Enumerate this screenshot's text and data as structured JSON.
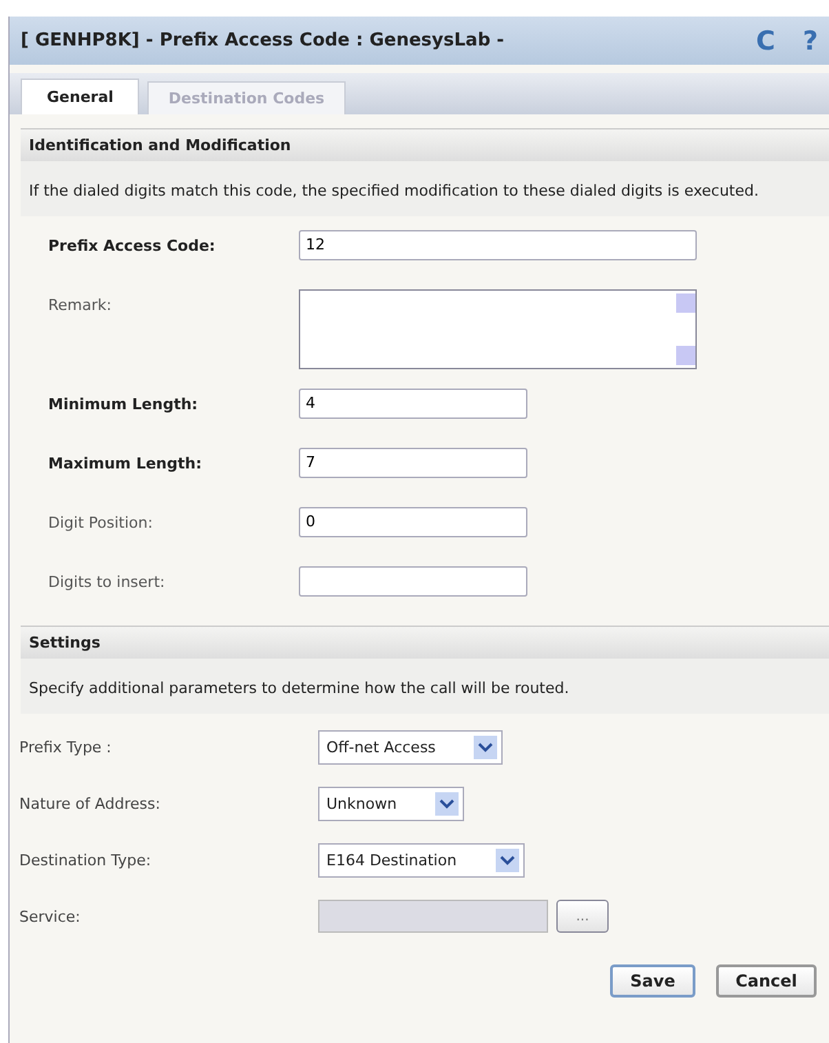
{
  "window": {
    "title": "[ GENHP8K] - Prefix Access Code : GenesysLab -",
    "refresh_icon": "C",
    "help_icon": "?"
  },
  "tabs": [
    {
      "label": "General",
      "selected": true
    },
    {
      "label": "Destination Codes",
      "selected": false
    }
  ],
  "identification": {
    "header": "Identification and Modification",
    "description": "If the dialed digits match this code, the specified modification to these dialed digits is executed.",
    "fields": [
      {
        "kind": "text",
        "label": "Prefix Access Code:",
        "required": true,
        "value": "12"
      },
      {
        "kind": "textarea",
        "label": "Remark:",
        "required": false
      },
      {
        "kind": "text",
        "label": "Minimum Length:",
        "required": true,
        "value": "4"
      },
      {
        "kind": "text",
        "label": "Maximum Length:",
        "required": true,
        "value": "7"
      },
      {
        "kind": "text",
        "label": "Digit Position:",
        "required": false,
        "value": "0"
      },
      {
        "kind": "text",
        "label": "Digits to insert:",
        "required": false
      }
    ]
  },
  "settings": {
    "header": "Settings",
    "description": "Specify additional parameters to determine how the call will be routed.",
    "fields": [
      {
        "kind": "select",
        "label": "Prefix Type :",
        "value": "Off-net Access"
      },
      {
        "kind": "select",
        "label": "Nature of Address:",
        "value": "Unknown"
      },
      {
        "kind": "select",
        "label": "Destination Type:",
        "value": "E164 Destination"
      },
      {
        "kind": "lookup",
        "label": "Service:",
        "disabled": true,
        "button": "..."
      }
    ]
  },
  "buttons": [
    {
      "label": "Save",
      "kind": "primary"
    },
    {
      "label": "Cancel",
      "kind": "secondary"
    }
  ]
}
